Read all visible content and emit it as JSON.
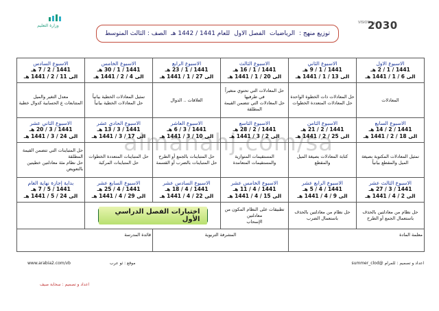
{
  "header": {
    "logo_left_text": "وزارة التعليم",
    "logo_right_big": "2030",
    "logo_right_small": "VISION رؤية",
    "title_parts": [
      "توزيع منهج :",
      "الرياضيات",
      "الفصل الاول",
      "للعام 1441 / 1442 هـ",
      "الصف : الثالث المتوسط"
    ]
  },
  "rows": [
    {
      "weeks": [
        {
          "name": "الاسبوع الاول",
          "from": "1441 / 1 / 2 هـ",
          "to": "الى 6 / 1 / 1441 هـ"
        },
        {
          "name": "الاسبوع الثاني",
          "from": "1441 / 1 / 9 هـ",
          "to": "الى 13 / 1 / 1441 هـ"
        },
        {
          "name": "الاسبوع الثالث",
          "from": "1441 / 1 / 16 هـ",
          "to": "الى 20 / 1 / 1441 هـ"
        },
        {
          "name": "الاسبوع الرابع",
          "from": "1441 / 1 / 23 هـ",
          "to": "الى 27 / 1 / 1441 هـ"
        },
        {
          "name": "الاسبوع الخامس",
          "from": "1441 / 1 / 30 هـ",
          "to": "الى 4 / 2 / 1441 هـ"
        },
        {
          "name": "الاسبوع السادس",
          "from": "1441 / 2 / 7 هـ",
          "to": "الى 11 / 2 / 1441 هـ"
        }
      ],
      "topics": [
        [
          "المعادلات"
        ],
        [
          "حل المعادلات ذات الخطوة الواحدة",
          "حل المعادلات المتعددة الخطوات"
        ],
        [
          "حل المعادلات التي تحتوي متغيراً في طرفيها",
          "حل المعادلات التي تتضمن القيمة المطلقة"
        ],
        [
          "العلاقات .. الدوال"
        ],
        [
          "تمثيل المعادلات الخطية بيانياً",
          "حل المعادلات الخطية بيانياً"
        ],
        [
          "معدل التغير والميل",
          "المتتابعات ع الحسابية كدوال خطية"
        ]
      ]
    },
    {
      "weeks": [
        {
          "name": "الاسبوع السابع",
          "from": "1441 / 2 / 14 هـ",
          "to": "الى 18 / 2 / 1441 هـ"
        },
        {
          "name": "الاسبوع الثامن",
          "from": "1441 / 2 / 21 هـ",
          "to": "الى 25 / 2 / 1441 هـ"
        },
        {
          "name": "الاسبوع التاسع",
          "from": "1441 / 2 / 28 هـ",
          "to": "الى 2 / 3 / 1441 هـ"
        },
        {
          "name": "الاسبوع العاشر",
          "from": "1441 / 3 / 6 هـ",
          "to": "الى 10 / 3 / 1441 هـ"
        },
        {
          "name": "الاسبوع الحادي عشر",
          "from": "1441 / 3 / 13 هـ",
          "to": "الى 17 / 3 / 1441 هـ"
        },
        {
          "name": "الاسبوع الثاني عشر",
          "from": "1441 / 3 / 20 هـ",
          "to": "الى 24 / 3 / 1441 هـ"
        }
      ],
      "topics": [
        [
          "تمثيل المعادلات المكتوبة بصيغة الميل والمقطع بيانياً"
        ],
        [
          "كتابة المعادلات بصيغة الميل والمقطع"
        ],
        [
          "المستقيمات المتوازية والمستقيمات المتعامدة"
        ],
        [
          "حل المتباينات بالجمع أو الطرح",
          "حل المتباينات بالضرب أو القسمة"
        ],
        [
          "حل المتباينات المتعددة الخطوات",
          "حل المتباينات المركبة"
        ],
        [
          "حل المتباينات التي تتضمن القيمة المطلقة",
          "حل نظام مئة معادلتين خطيتين بالتعويض"
        ]
      ]
    },
    {
      "weeks": [
        {
          "name": "الاسبوع الثالث عشر",
          "from": "1441 / 3 / 27 هـ",
          "to": "الى 2 / 4 / 1441 هـ"
        },
        {
          "name": "الاسبوع الرابع عشر",
          "from": "1441 / 4 / 5 هـ",
          "to": "الى 9 / 4 / 1441 هـ"
        },
        {
          "name": "الاسبوع الخامس عشر",
          "from": "1441 / 4 / 11 هـ",
          "to": "الى 15 / 4 / 1441 هـ"
        },
        {
          "name": "الاسبوع السادس عشر",
          "from": "1441 / 4 / 18 هـ",
          "to": "الى 22 / 4 / 1441 هـ"
        },
        {
          "name": "الاسبوع السابع عشر",
          "from": "1441 / 4 / 25 هـ",
          "to": "الى 29 / 4 / 1441 هـ"
        },
        {
          "name": "بداية إجازة نهاية العام",
          "from": "1441 / 5 / 7 هـ",
          "to": "الى 24 / 5 / 1441 هـ"
        }
      ],
      "topics": [
        [
          "حل نظام من معادلتين بالحذف باستعمال الجمع أو الطرح"
        ],
        [
          "حل نظام من معادلتين بالحذف باستعمال الضرب"
        ],
        [
          "تطبيقات على النظام المكون من معادلتين",
          "الإسحاب"
        ]
      ],
      "exam_label": "اختبارات الفصل الدراسي الأول"
    }
  ],
  "signatures": {
    "teacher": "معلمة المادة",
    "supervisor": "المشرفة التربوية",
    "principal": "قائدة المدرسة"
  },
  "footer": {
    "prepared_by": "اعداد و تصميم : للمرام",
    "handle": "@summer_clod",
    "site_label": "موقع : ثو عرب",
    "site_url": "www.arabia2.com/vb",
    "credit": "اعداد و تصميم : سحابة صيف"
  },
  "watermark": "almanahj.com/sa"
}
